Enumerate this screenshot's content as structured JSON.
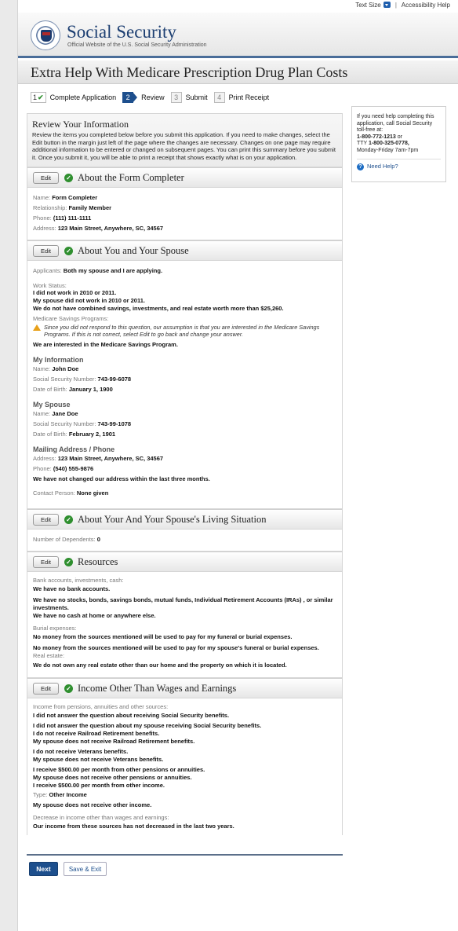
{
  "utility": {
    "text_size": "Text Size",
    "separator": "|",
    "accessibility": "Accessibility Help"
  },
  "brand": {
    "title": "Social Security",
    "subtitle": "Official Website of the U.S. Social Security Administration"
  },
  "page_title": "Extra Help With Medicare Prescription Drug Plan Costs",
  "steps": [
    {
      "num": "1",
      "label": "Complete Application",
      "state": "done"
    },
    {
      "num": "2",
      "label": "Review",
      "state": "active"
    },
    {
      "num": "3",
      "label": "Submit",
      "state": "pending"
    },
    {
      "num": "4",
      "label": "Print Receipt",
      "state": "pending"
    }
  ],
  "help": {
    "text": "If you need help completing this application, call Social Security toll-free at:",
    "phone1": "1-800-772-1213",
    "or": " or",
    "tty_label": "TTY ",
    "tty": "1-800-325-0778,",
    "hours": "Monday-Friday 7am-7pm",
    "need_help": "Need Help?"
  },
  "review": {
    "heading": "Review Your Information",
    "text": "Review the items you completed below before you submit this application. If you need to make changes, select the Edit button in the margin just left of the page where the changes are necessary. Changes on one page may require additional information to be entered or changed on subsequent pages. You can print this summary before you submit it. Once you submit it, you will be able to print a receipt that shows exactly what is on your application."
  },
  "edit_label": "Edit",
  "sections": {
    "form_completer": {
      "title": "About the Form Completer",
      "rows": [
        {
          "label": "Name:",
          "value": "Form Completer"
        },
        {
          "label": "Relationship:",
          "value": "Family Member"
        },
        {
          "label": "Phone:",
          "value": "(111) 111-1111"
        },
        {
          "label": "Address:",
          "value": "123 Main Street, Anywhere, SC, 34567"
        }
      ]
    },
    "you_spouse": {
      "title": "About You and Your Spouse",
      "applicants_label": "Applicants:",
      "applicants_value": "Both my spouse and I are applying.",
      "work_status_label": "Work Status:",
      "work_status": [
        "I did not work in 2010 or 2011.",
        "My spouse did not work in 2010 or 2011.",
        "We do not have combined savings, investments, and real estate worth more than $25,260."
      ],
      "msp_label": "Medicare Savings Programs:",
      "msp_warning": "Since you did not respond to this question, our assumption is that you are interested in the Medicare Savings Programs. If this is not correct, select Edit to go back and change your answer.",
      "msp_value": "We are interested in the Medicare Savings Program.",
      "my_info": {
        "heading": "My Information",
        "rows": [
          {
            "label": "Name:",
            "value": "John Doe"
          },
          {
            "label": "Social Security Number:",
            "value": "743-99-6078"
          },
          {
            "label": "Date of Birth:",
            "value": "January 1, 1900"
          }
        ]
      },
      "spouse": {
        "heading": "My Spouse",
        "rows": [
          {
            "label": "Name:",
            "value": "Jane Doe"
          },
          {
            "label": "Social Security Number:",
            "value": "743-99-1078"
          },
          {
            "label": "Date of Birth:",
            "value": "February 2, 1901"
          }
        ]
      },
      "mailing": {
        "heading": "Mailing Address / Phone",
        "rows": [
          {
            "label": "Address:",
            "value": "123 Main Street, Anywhere, SC, 34567"
          },
          {
            "label": "Phone:",
            "value": "(540) 555-9876"
          }
        ],
        "note": "We have not changed our address within the last three months.",
        "contact_label": "Contact Person:",
        "contact_value": "None given"
      }
    },
    "living": {
      "title": "About Your And Your Spouse's Living Situation",
      "dependents_label": "Number of Dependents:",
      "dependents_value": "0"
    },
    "resources": {
      "title": "Resources",
      "bank_label": "Bank accounts, investments, cash:",
      "bank_items": [
        "We have no bank accounts.",
        "We have no stocks, bonds, savings bonds, mutual funds, Individual Retirement Accounts (IRAs) , or similar investments.",
        "We have no cash at home or anywhere else."
      ],
      "burial_label": "Burial expenses:",
      "burial_items": [
        "No money from the sources mentioned will be used to pay for my funeral or burial expenses.",
        "No money from the sources mentioned will be used to pay for my spouse's funeral or burial expenses."
      ],
      "real_estate_label": "Real estate:",
      "real_estate_value": "We do not own any real estate other than our home and the property on which it is located."
    },
    "income": {
      "title": "Income Other Than Wages and Earnings",
      "sources_label": "Income from pensions, annuities and other sources:",
      "sources_items": [
        "I did not answer the question about receiving Social Security benefits.",
        "I did not answer the question about my spouse receiving Social Security benefits.",
        "I do not receive Railroad Retirement benefits.",
        "My spouse does not receive Railroad Retirement benefits.",
        "I do not receive Veterans benefits.",
        "My spouse does not receive Veterans benefits.",
        "I receive $500.00 per month from other pensions or annuities.",
        "My spouse does not receive other pensions or annuities.",
        "I receive $500.00 per month from other income."
      ],
      "type_label": "Type:",
      "type_value": "Other Income",
      "spouse_other": "My spouse does not receive other income.",
      "decrease_label": "Decrease in income other than wages and earnings:",
      "decrease_value": "Our income from these sources has not decreased in the last two years."
    }
  },
  "footer": {
    "next": "Next",
    "save_exit": "Save & Exit"
  },
  "colors": {
    "brand_blue": "#1d4f8d",
    "check_green": "#2f8f2f",
    "warning": "#e8a019"
  }
}
